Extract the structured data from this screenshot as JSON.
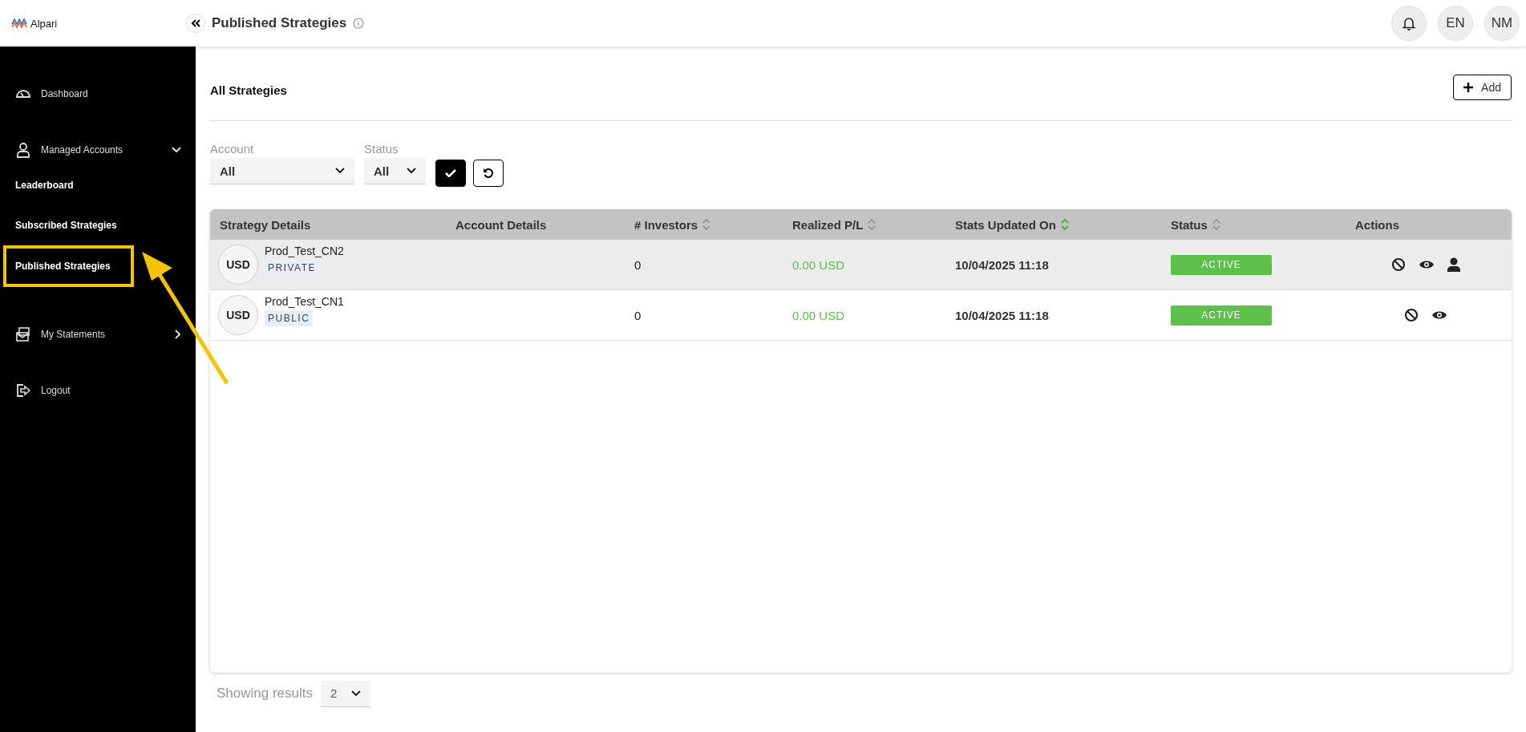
{
  "header": {
    "logo": "Alpari",
    "title": "Published Strategies",
    "buttons": [
      {
        "kind": "bell"
      },
      {
        "kind": "text",
        "label": "EN"
      },
      {
        "kind": "text",
        "label": "NM"
      }
    ]
  },
  "sidebar": {
    "items": [
      {
        "label": "Dashboard",
        "kind": "dashboard"
      },
      {
        "label": "Managed Accounts",
        "kind": "person",
        "expanded": true,
        "children": [
          {
            "label": "Leaderboard"
          },
          {
            "label": "Subscribed Strategies"
          },
          {
            "label": "Published Strategies",
            "annotated": true
          }
        ]
      },
      {
        "label": "My Statements",
        "kind": "statements",
        "expanded": false
      },
      {
        "label": "Logout",
        "kind": "logout"
      }
    ]
  },
  "section": {
    "title": "All Strategies",
    "add_button": "Add"
  },
  "filters": [
    {
      "label": "Account",
      "value": "All",
      "kind": "wide"
    },
    {
      "label": "Status",
      "value": "All",
      "kind": "narrow"
    }
  ],
  "filter_buttons": [
    {
      "kind": "apply"
    },
    {
      "kind": "reset"
    }
  ],
  "table": {
    "columns": [
      {
        "label": "Strategy Details"
      },
      {
        "label": "Account Details"
      },
      {
        "label": "# Investors",
        "sortable": true,
        "sorted": false
      },
      {
        "label": "Realized P/L",
        "sortable": true,
        "sorted": false
      },
      {
        "label": "Stats Updated On",
        "sortable": true,
        "sorted": true
      },
      {
        "label": "Status",
        "sortable": true,
        "sorted": false
      },
      {
        "label": "Actions"
      }
    ],
    "rows": [
      {
        "currency": "USD",
        "name": "Prod_Test_CN2",
        "visibility": "PRIVATE",
        "investors": "0",
        "realized_pl": "0.00 USD",
        "stats_updated_on": "10/04/2025 11:18",
        "status": "ACTIVE",
        "actions": [
          {
            "kind": "block"
          },
          {
            "kind": "view"
          },
          {
            "kind": "person"
          }
        ],
        "selected": true
      },
      {
        "currency": "USD",
        "name": "Prod_Test_CN1",
        "visibility": "PUBLIC",
        "investors": "0",
        "realized_pl": "0.00 USD",
        "stats_updated_on": "10/04/2025 11:18",
        "status": "ACTIVE",
        "actions": [
          {
            "kind": "block"
          },
          {
            "kind": "view"
          }
        ],
        "selected": false
      }
    ]
  },
  "footer": {
    "label": "Showing results",
    "value": "2"
  }
}
